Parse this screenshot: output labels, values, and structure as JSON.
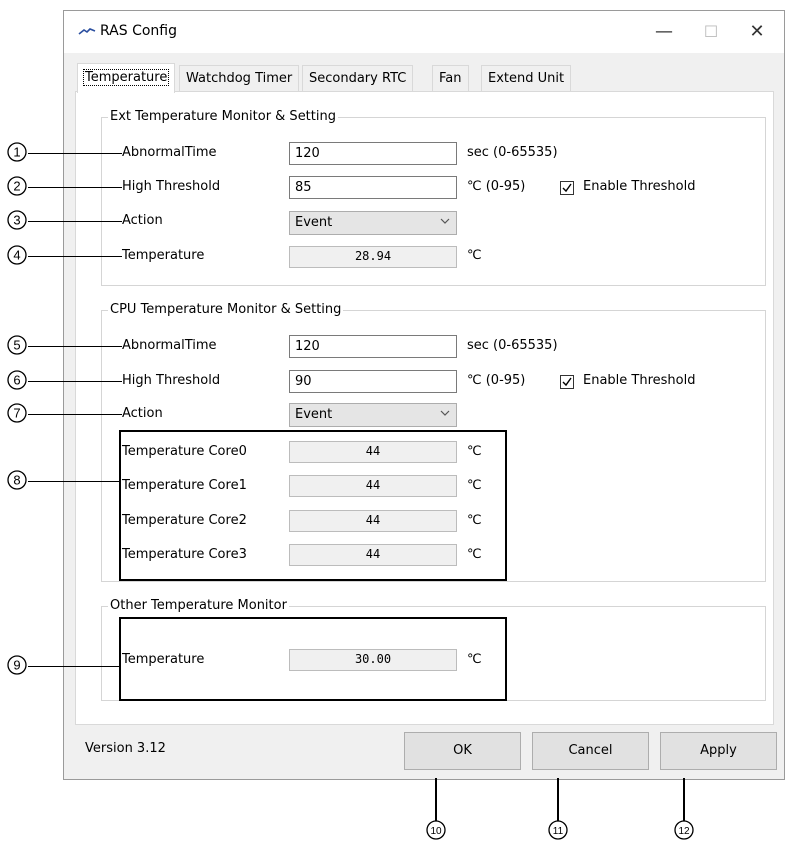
{
  "window": {
    "title": "RAS Config",
    "minimize": "—",
    "maximize": "☐",
    "close": "✕"
  },
  "tabs": [
    "Temperature",
    "Watchdog Timer",
    "Secondary RTC",
    "Fan",
    "Extend Unit"
  ],
  "ext": {
    "group_title": "Ext Temperature Monitor & Setting",
    "abnormal_label": "AbnormalTime",
    "abnormal_value": "120",
    "abnormal_unit": "sec (0-65535)",
    "threshold_label": "High Threshold",
    "threshold_value": "85",
    "threshold_unit": "℃ (0-95)",
    "enable_label": "Enable Threshold",
    "action_label": "Action",
    "action_value": "Event",
    "temp_label": "Temperature",
    "temp_value": "28.94",
    "temp_unit": "℃"
  },
  "cpu": {
    "group_title": "CPU Temperature Monitor & Setting",
    "abnormal_label": "AbnormalTime",
    "abnormal_value": "120",
    "abnormal_unit": "sec (0-65535)",
    "threshold_label": "High Threshold",
    "threshold_value": "90",
    "threshold_unit": "℃ (0-95)",
    "enable_label": "Enable Threshold",
    "action_label": "Action",
    "action_value": "Event",
    "cores": [
      {
        "label": "Temperature Core0",
        "value": "44",
        "unit": "℃"
      },
      {
        "label": "Temperature Core1",
        "value": "44",
        "unit": "℃"
      },
      {
        "label": "Temperature Core2",
        "value": "44",
        "unit": "℃"
      },
      {
        "label": "Temperature Core3",
        "value": "44",
        "unit": "℃"
      }
    ]
  },
  "other": {
    "group_title": "Other Temperature Monitor",
    "temp_label": "Temperature",
    "temp_value": "30.00",
    "temp_unit": "℃"
  },
  "footer": {
    "version": "Version 3.12",
    "ok": "OK",
    "cancel": "Cancel",
    "apply": "Apply"
  },
  "callouts": [
    "1",
    "2",
    "3",
    "4",
    "5",
    "6",
    "7",
    "8",
    "9",
    "10",
    "11",
    "12"
  ]
}
